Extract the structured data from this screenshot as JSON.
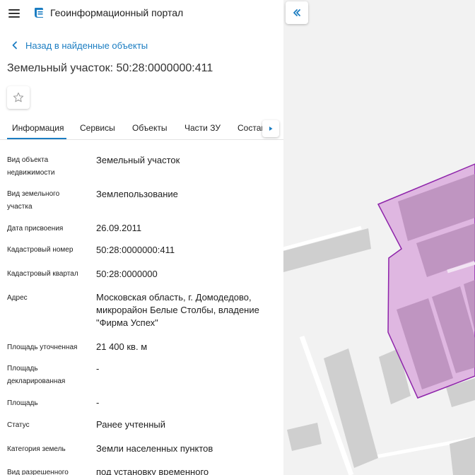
{
  "header": {
    "app_title": "Геоинформационный портал"
  },
  "nav": {
    "back_label": "Назад в найденные объекты"
  },
  "object": {
    "title": "Земельный участок: 50:28:0000000:411"
  },
  "tabs": [
    {
      "label": "Информация"
    },
    {
      "label": "Сервисы"
    },
    {
      "label": "Объекты"
    },
    {
      "label": "Части ЗУ"
    },
    {
      "label": "Состав"
    }
  ],
  "info": [
    {
      "label": "Вид объекта недвижимости",
      "value": "Земельный участок"
    },
    {
      "label": "Вид земельного участка",
      "value": "Землепользование"
    },
    {
      "label": "Дата присвоения",
      "value": "26.09.2011"
    },
    {
      "label": "Кадастровый номер",
      "value": "50:28:0000000:411"
    },
    {
      "label": "Кадастровый квартал",
      "value": "50:28:0000000"
    },
    {
      "label": "Адрес",
      "value": "Московская область, г. Домодедово, микрорайон Белые Столбы, владение \"Фирма Успех\""
    },
    {
      "label": "Площадь уточненная",
      "value": "21 400 кв. м"
    },
    {
      "label": "Площадь декларированная",
      "value": "-"
    },
    {
      "label": "Площадь",
      "value": "-"
    },
    {
      "label": "Статус",
      "value": "Ранее учтенный"
    },
    {
      "label": "Категория земель",
      "value": "Земли населенных пунктов"
    },
    {
      "label": "Вид разрешенного",
      "value": "под установку временного"
    }
  ],
  "colors": {
    "accent": "#1b7dc2",
    "parcel_fill": "#d9a8dc",
    "parcel_stroke": "#8e24aa",
    "map_bg": "#f2f2f2",
    "building": "#cfcfcf"
  },
  "icons": {
    "menu": "hamburger-icon",
    "logo": "portal-logo-icon",
    "back": "chevron-left-icon",
    "favorite": "star-outline-icon",
    "tabs_next": "triangle-right-icon",
    "collapse": "double-chevron-left-icon"
  }
}
